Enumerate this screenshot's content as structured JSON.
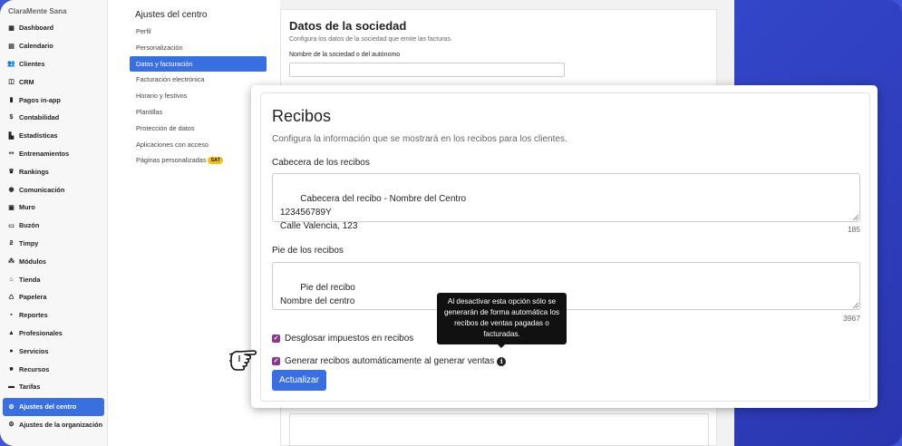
{
  "sidebar": {
    "brand": "ClaraMente Sana",
    "items": [
      {
        "label": "Dashboard",
        "icon": "grid-icon"
      },
      {
        "label": "Calendario",
        "icon": "calendar-icon"
      },
      {
        "label": "Clientes",
        "icon": "users-icon"
      },
      {
        "label": "CRM",
        "icon": "columns-icon"
      },
      {
        "label": "Pagos in-app",
        "icon": "phone-icon"
      },
      {
        "label": "Contabilidad",
        "icon": "dollar-icon"
      },
      {
        "label": "Estadísticas",
        "icon": "bar-chart-icon"
      },
      {
        "label": "Entrenamientos",
        "icon": "dumbbell-icon"
      },
      {
        "label": "Rankings",
        "icon": "trophy-icon"
      },
      {
        "label": "Comunicación",
        "icon": "chat-icon"
      },
      {
        "label": "Muro",
        "icon": "image-icon"
      },
      {
        "label": "Buzón",
        "icon": "inbox-icon"
      },
      {
        "label": "Timpy",
        "icon": "timpy-icon"
      },
      {
        "label": "Módulos",
        "icon": "modules-icon"
      },
      {
        "label": "Tienda",
        "icon": "shop-icon"
      },
      {
        "label": "Papelera",
        "icon": "recycle-icon"
      },
      {
        "label": "Reportes",
        "icon": "file-icon"
      },
      {
        "label": "Profesionales",
        "icon": "graduation-icon"
      },
      {
        "label": "Servicios",
        "icon": "circle-icon"
      },
      {
        "label": "Recursos",
        "icon": "box-icon"
      },
      {
        "label": "Tarifas",
        "icon": "ticket-icon"
      },
      {
        "label": "Ajustes del centro",
        "icon": "gear-icon",
        "active": true
      },
      {
        "label": "Ajustes de la organización",
        "icon": "gear-icon"
      }
    ]
  },
  "settings_menu": {
    "title": "Ajustes del centro",
    "items": [
      {
        "label": "Perfil"
      },
      {
        "label": "Personalización"
      },
      {
        "label": "Datos y facturación",
        "active": true
      },
      {
        "label": "Facturación electrónica"
      },
      {
        "label": "Horario y festivos"
      },
      {
        "label": "Plantillas"
      },
      {
        "label": "Protección de datos"
      },
      {
        "label": "Aplicaciones con acceso"
      },
      {
        "label": "Páginas personalizadas",
        "badge": "SAT"
      }
    ]
  },
  "background_card": {
    "title": "Datos de la sociedad",
    "subtitle": "Configura los datos de la sociedad que emite las facturas.",
    "field_label": "Nombre de la sociedad o del autónomo"
  },
  "modal": {
    "title": "Recibos",
    "subtitle": "Configura la información que se mostrará en los recibos para los clientes.",
    "header_label": "Cabecera de los recibos",
    "header_value": "Cabecera del recibo - Nombre del Centro\n123456789Y\nCalle Valencia, 123",
    "header_counter": "185",
    "footer_label": "Pie de los recibos",
    "footer_value": "Pie del recibo\nNombre del centro",
    "footer_counter": "3967",
    "check_taxes": "Desglosar impuestos en recibos",
    "check_auto": "Generar recibos automáticamente al generar ventas",
    "update_button": "Actualizar",
    "tooltip": "Al desactivar esta opción sólo se generarán de forma automática los recibos de ventas pagadas o facturadas."
  },
  "colors": {
    "accent": "#3a6fe0",
    "checkbox": "#8a3a8e",
    "badge": "#f3c01a",
    "background": "#3346c9"
  }
}
